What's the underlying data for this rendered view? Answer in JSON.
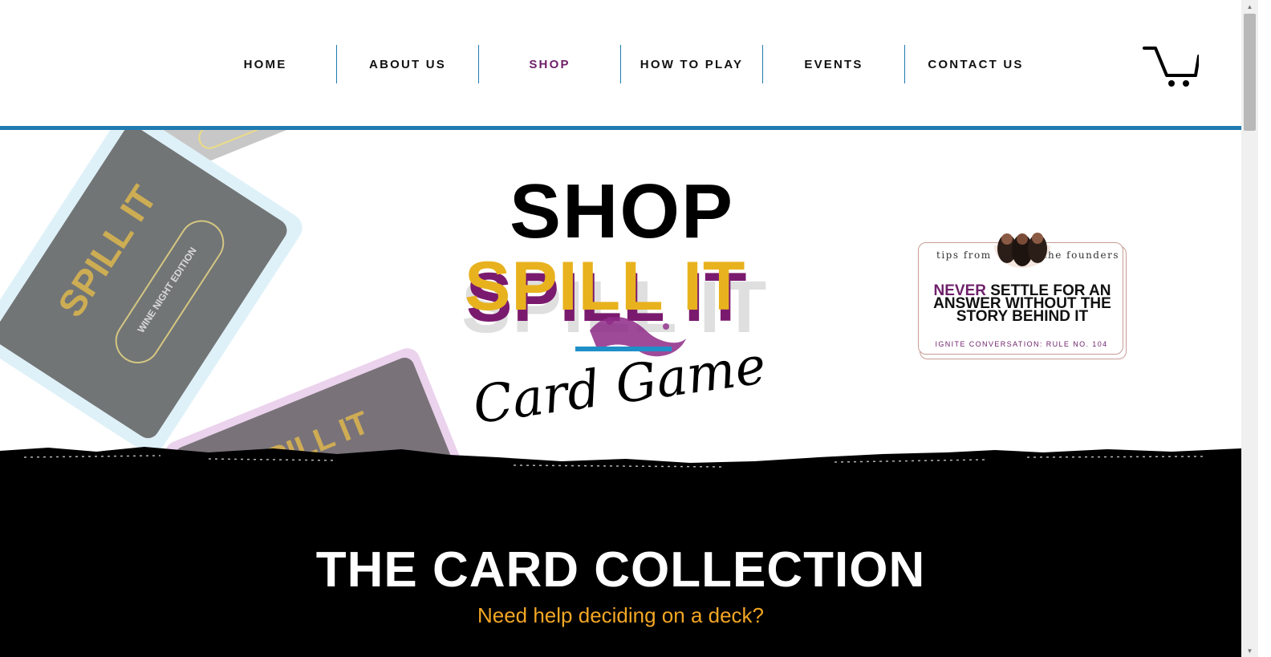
{
  "nav": {
    "items": [
      {
        "label": "HOME"
      },
      {
        "label": "ABOUT US"
      },
      {
        "label": "SHOP",
        "active": true
      },
      {
        "label": "HOW TO PLAY"
      },
      {
        "label": "EVENTS"
      },
      {
        "label": "CONTACT US"
      }
    ],
    "cart_icon": "shopping-cart-icon"
  },
  "colors": {
    "accent_blue": "#1f7ab0",
    "brand_purple": "#6e1f6a",
    "brand_yellow": "#e8b21e",
    "subtitle_orange": "#f2a623"
  },
  "hero": {
    "title": "SHOP",
    "logo_main": "SPILL IT",
    "logo_script": "Card Game",
    "bg_card_label": "SPILL IT",
    "bg_card_edition": "WINE NIGHT EDITION"
  },
  "tip": {
    "tag_left": "tips from",
    "tag_right": "the founders",
    "highlight": "NEVER",
    "text": "SETTLE FOR AN ANSWER WITHOUT THE STORY BEHIND IT",
    "rule": "IGNITE CONVERSATION: RULE NO. 104"
  },
  "collection": {
    "title": "THE CARD COLLECTION",
    "subtitle": "Need help deciding on a deck?"
  }
}
